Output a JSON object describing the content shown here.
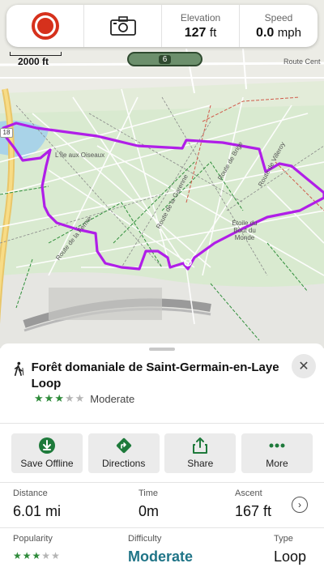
{
  "topbar": {
    "elevation": {
      "label": "Elevation",
      "value": "127",
      "unit": "ft"
    },
    "speed": {
      "label": "Speed",
      "value": "0.0",
      "unit": "mph"
    }
  },
  "map": {
    "scale_label": "2000 ft",
    "route_badge": "6",
    "road_label_top": "Route Cent",
    "shield_label": "18",
    "places": {
      "ile_aux_oiseaux": "L'Île aux Oiseaux",
      "etoile": "Étoile du Bout du Monde"
    },
    "roads": {
      "ferme": "Route de la Ferme",
      "garenne": "Route de la Garenne",
      "brise": "Route de Brige",
      "villeroy": "Route de Villeroy"
    }
  },
  "trail": {
    "title": "Forêt domaniale de Saint-Germain-en-Laye Loop",
    "rating_stars": 3,
    "rating_max": 5,
    "rating_text": "Moderate"
  },
  "actions": [
    {
      "label": "Save Offline",
      "icon": "download-icon"
    },
    {
      "label": "Directions",
      "icon": "directions-icon"
    },
    {
      "label": "Share",
      "icon": "share-icon"
    },
    {
      "label": "More",
      "icon": "more-icon"
    }
  ],
  "stats": {
    "distance": {
      "label": "Distance",
      "value": "6.01 mi"
    },
    "time": {
      "label": "Time",
      "value": "0m"
    },
    "ascent": {
      "label": "Ascent",
      "value": "167 ft"
    },
    "popularity": {
      "label": "Popularity",
      "stars": 3
    },
    "difficulty": {
      "label": "Difficulty",
      "value": "Moderate"
    },
    "type": {
      "label": "Type",
      "value": "Loop"
    }
  },
  "colors": {
    "route": "#b01ee8",
    "accent": "#1f7487",
    "action_green": "#1e7a3b",
    "record_red": "#d6311c"
  }
}
